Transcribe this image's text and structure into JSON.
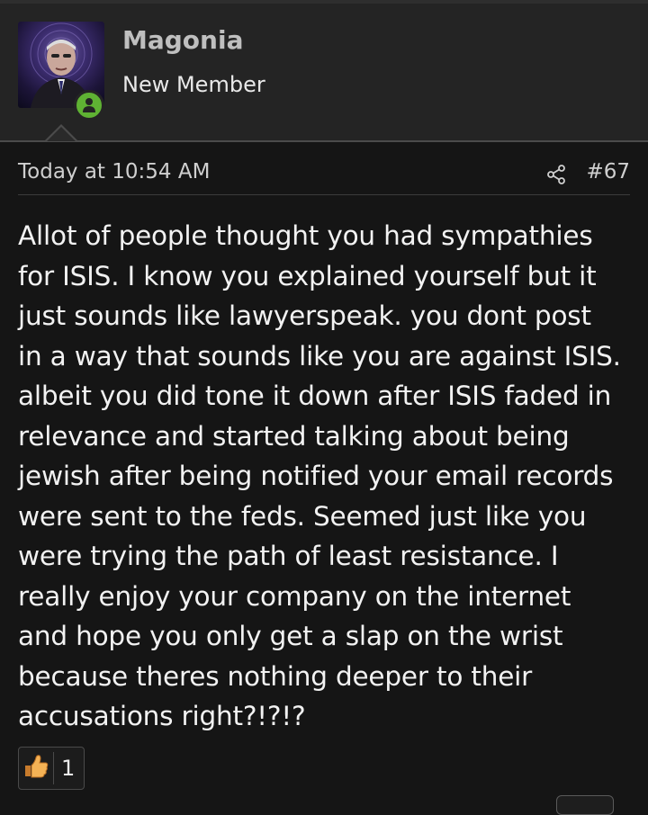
{
  "user": {
    "name": "Magonia",
    "title": "New Member",
    "avatar_icon": "avatar-portrait",
    "status_icon": "online-user-icon",
    "status_color": "#5fb233"
  },
  "post": {
    "date": "Today at 10:54 AM",
    "share_icon": "share-icon",
    "number": "#67",
    "body": "Allot of people thought you had sympathies\nfor ISIS. I know you explained yourself but it\njust sounds like lawyerspeak. you dont post\nin a way that sounds like you are against ISIS.\nalbeit you did tone it down after ISIS faded in\nrelevance and started talking about being\njewish after being notified your email records\nwere sent to the feds. Seemed just like you\nwere trying the path of least resistance. I\nreally enjoy your company on the internet\nand hope you only get a slap on the wrist\nbecause theres nothing deeper to their\naccusations right?!?!?"
  },
  "reactions": {
    "like_icon": "thumbs-up-icon",
    "like_count": "1"
  }
}
